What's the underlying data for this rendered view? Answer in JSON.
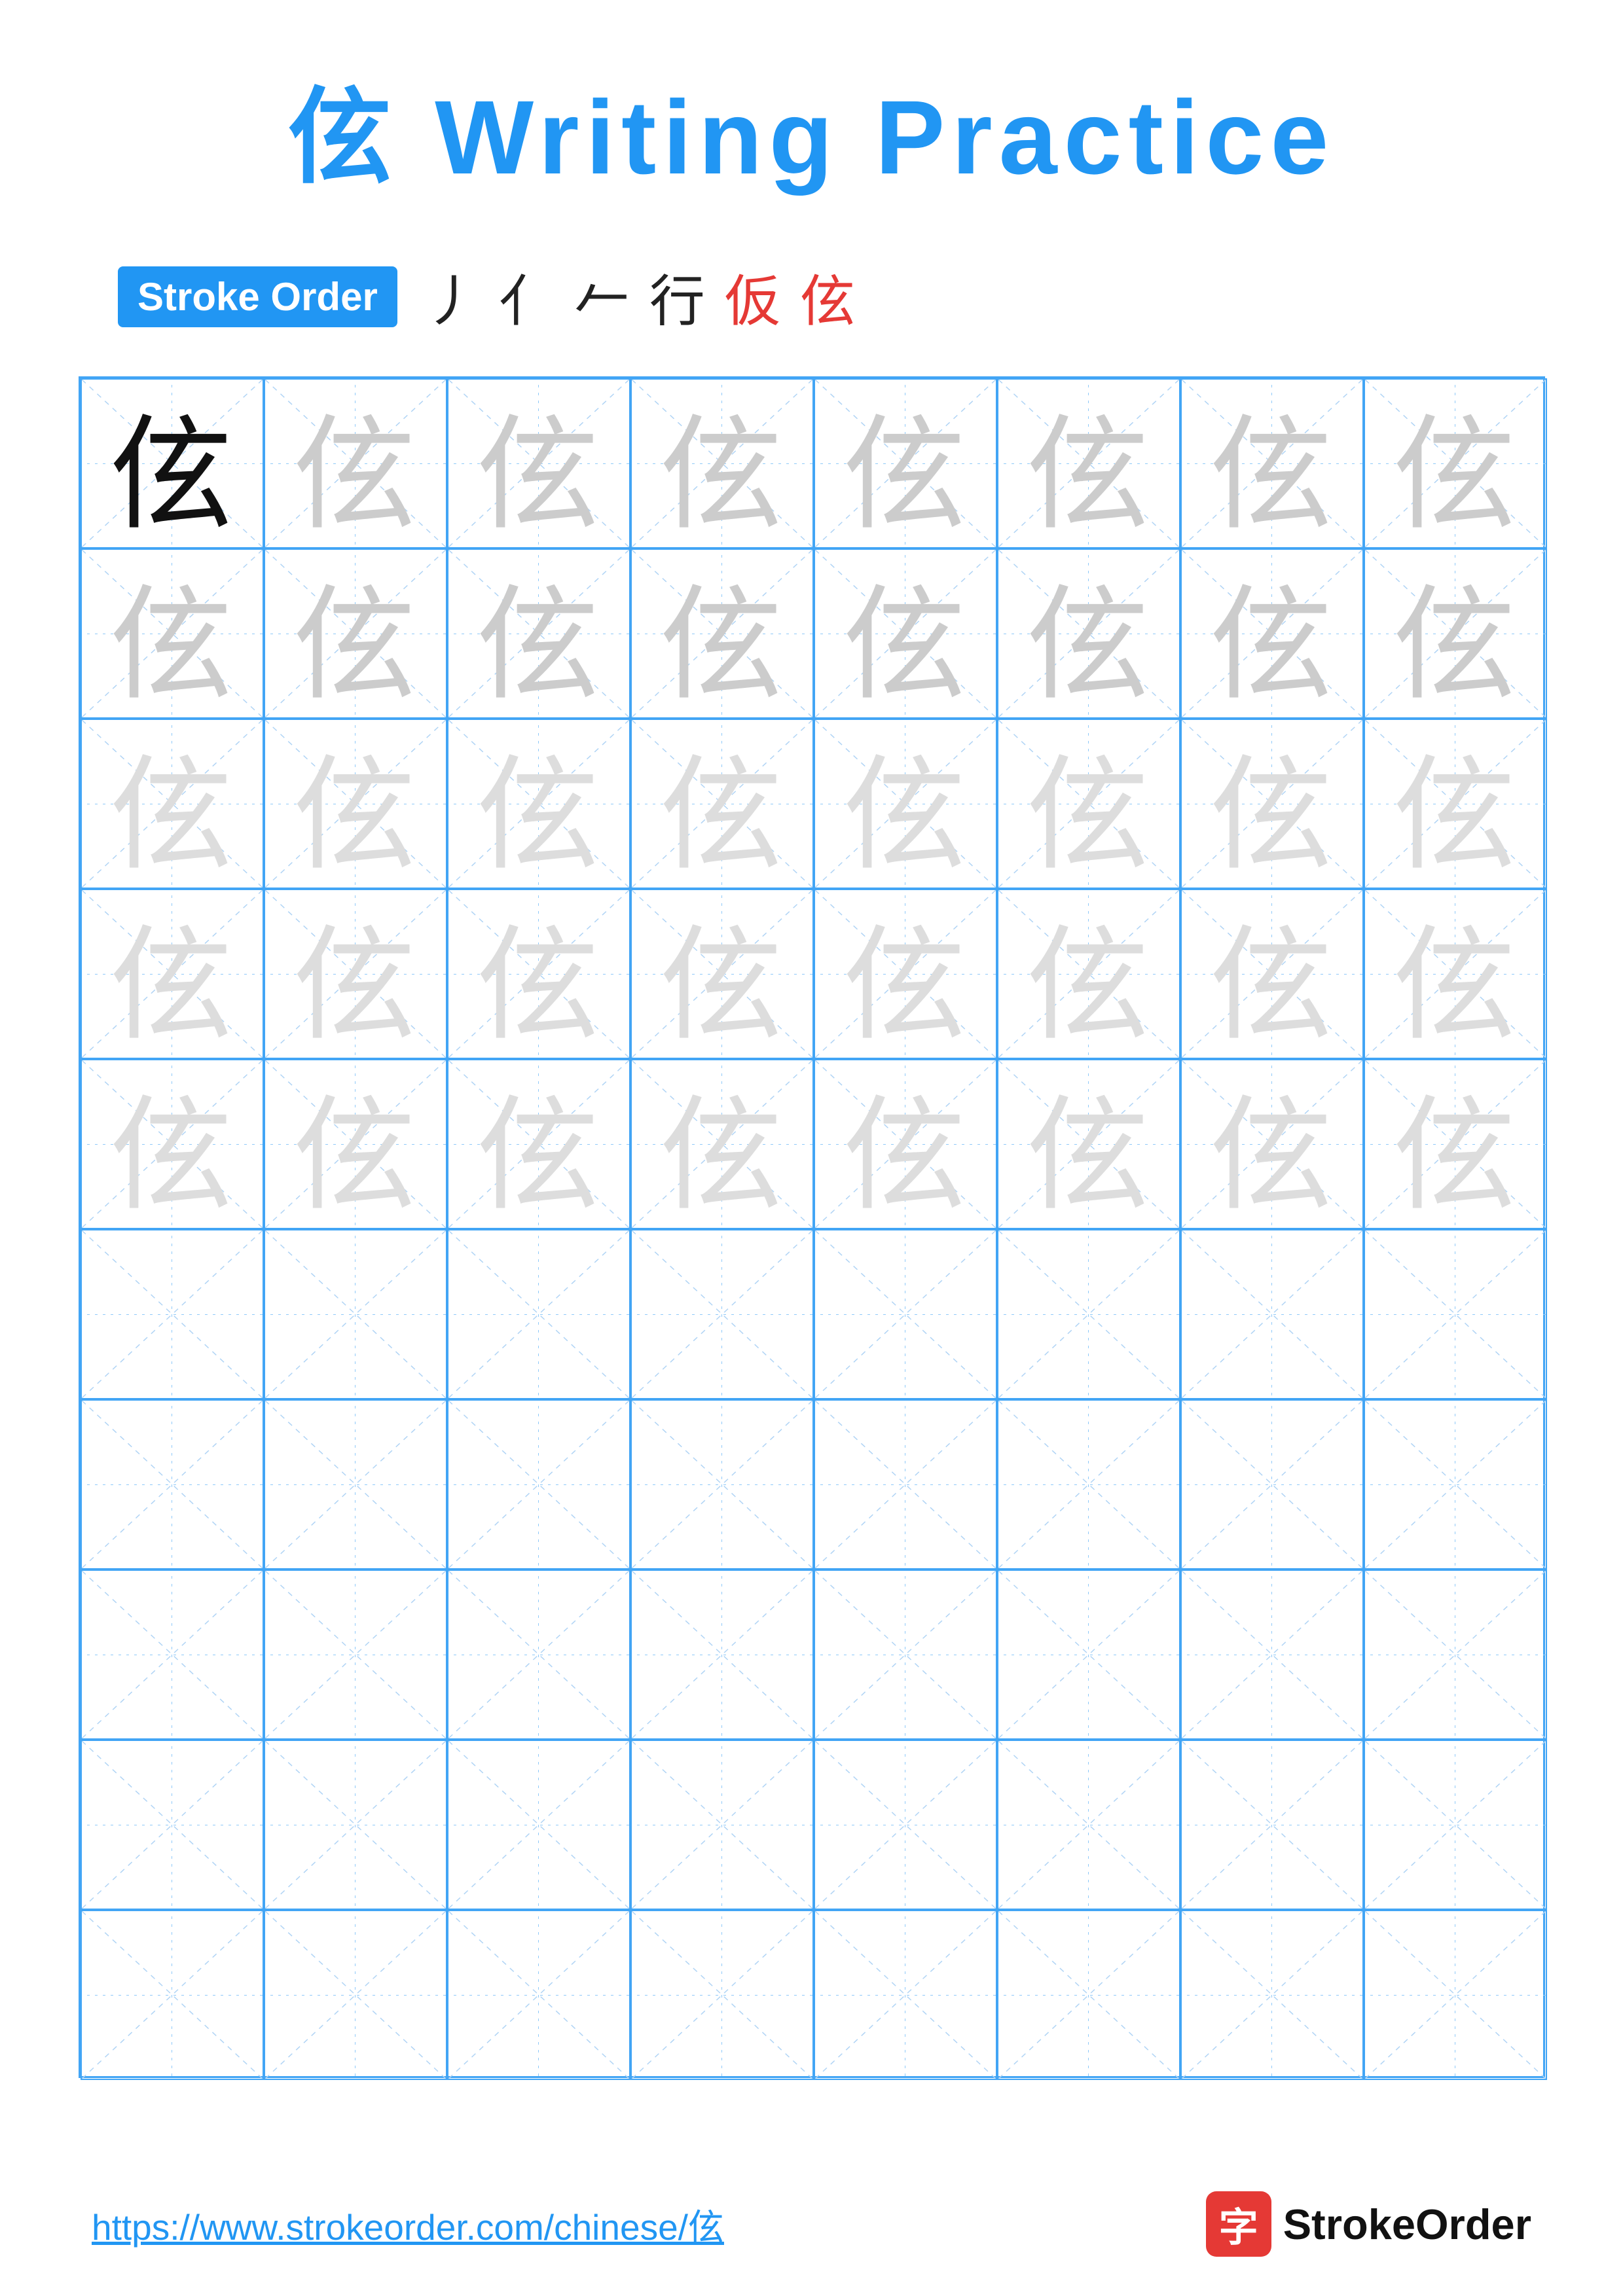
{
  "title": {
    "character": "伭",
    "label": "Writing Practice"
  },
  "stroke_order": {
    "badge_label": "Stroke Order",
    "strokes": [
      "丿",
      "亻",
      "𠂉",
      "行",
      "仮",
      "伭"
    ]
  },
  "grid": {
    "cols": 8,
    "rows": 10,
    "character": "伭",
    "faint_rows": 5,
    "empty_rows": 5
  },
  "footer": {
    "url": "https://www.strokeorder.com/chinese/伭",
    "logo_text": "StrokeOrder",
    "logo_char": "字"
  }
}
